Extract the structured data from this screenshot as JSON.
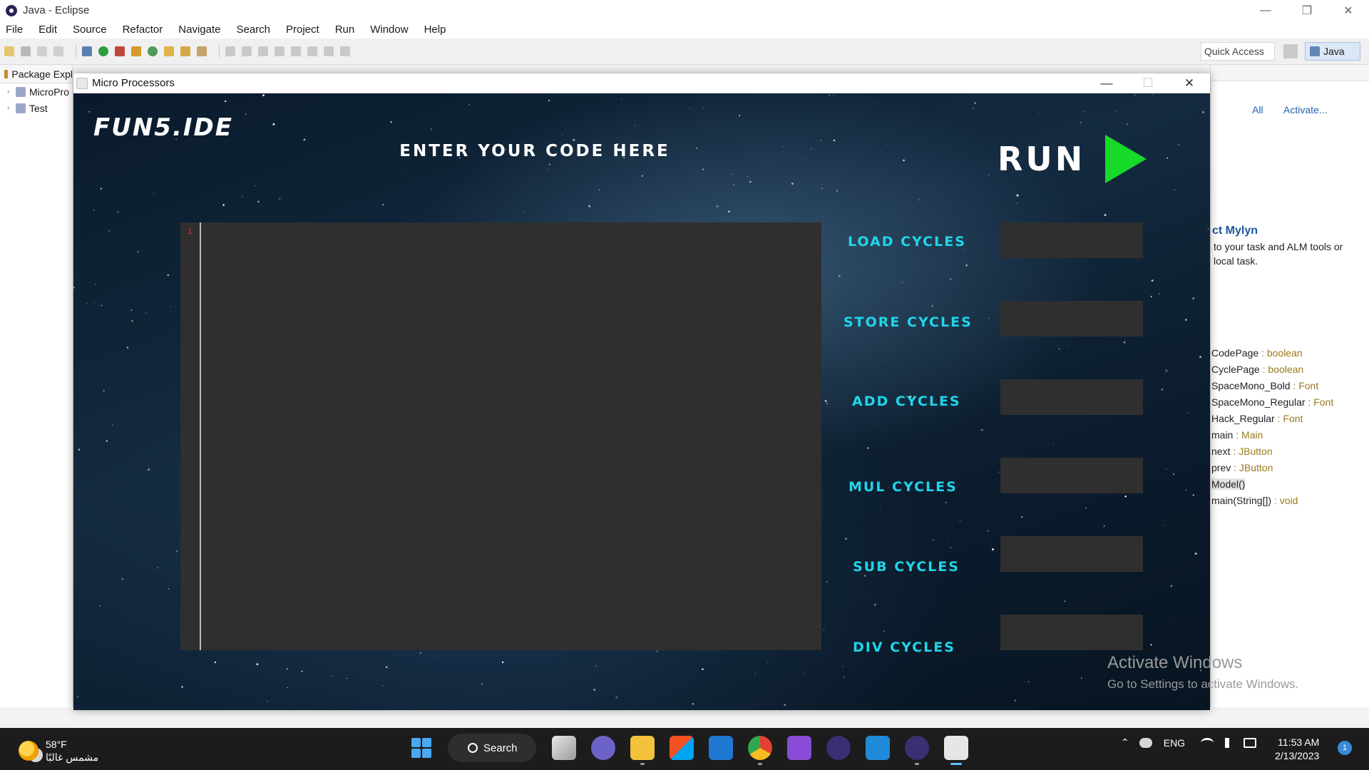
{
  "eclipse": {
    "title": "Java - Eclipse",
    "menu": [
      "File",
      "Edit",
      "Source",
      "Refactor",
      "Navigate",
      "Search",
      "Project",
      "Run",
      "Window",
      "Help"
    ],
    "quick_access": "Quick Access",
    "perspective": "Java",
    "package_explorer": {
      "tab_label": "Package Expl",
      "items": [
        "MicroPro",
        "Test"
      ]
    },
    "task_list": {
      "all": "All",
      "activate": "Activate..."
    },
    "mylyn": {
      "title": "ct Mylyn",
      "line1": "to your task and ALM tools or",
      "line2": "local task."
    },
    "outline": [
      {
        "name": "CodePage",
        "type": " : boolean"
      },
      {
        "name": "CyclePage",
        "type": " : boolean"
      },
      {
        "name": "SpaceMono_Bold",
        "type": " : Font"
      },
      {
        "name": "SpaceMono_Regular",
        "type": " : Font"
      },
      {
        "name": "Hack_Regular",
        "type": " : Font"
      },
      {
        "name": "main",
        "type": " : Main"
      },
      {
        "name": "next",
        "type": " : JButton"
      },
      {
        "name": "prev",
        "type": " : JButton"
      },
      {
        "name": "Model()",
        "type": ""
      },
      {
        "name": "main(String[])",
        "type": " : void"
      }
    ]
  },
  "dialog": {
    "title": "Micro Processors",
    "logo": "FUN5.IDE",
    "heading": "ENTER YOUR CODE HERE",
    "run_label": "RUN",
    "editor": {
      "line_number": "1",
      "code": ""
    },
    "cycles": [
      {
        "label": "LOAD CYCLES",
        "value": ""
      },
      {
        "label": "STORE CYCLES",
        "value": ""
      },
      {
        "label": "ADD CYCLES",
        "value": ""
      },
      {
        "label": "MUL CYCLES",
        "value": ""
      },
      {
        "label": "SUB CYCLES",
        "value": ""
      },
      {
        "label": "DIV CYCLES",
        "value": ""
      }
    ]
  },
  "watermark": {
    "line1": "Activate Windows",
    "line2": "Go to Settings to activate Windows."
  },
  "taskbar": {
    "weather_temp": "58°F",
    "weather_desc": "مشمس غالبًا",
    "search": "Search",
    "language": "ENG",
    "time": "11:53 AM",
    "date": "2/13/2023",
    "notifications": "1"
  },
  "colors": {
    "accent_cyan": "#1fd6ea",
    "run_green": "#17d92a",
    "editor_bg": "#2f2f2f"
  }
}
